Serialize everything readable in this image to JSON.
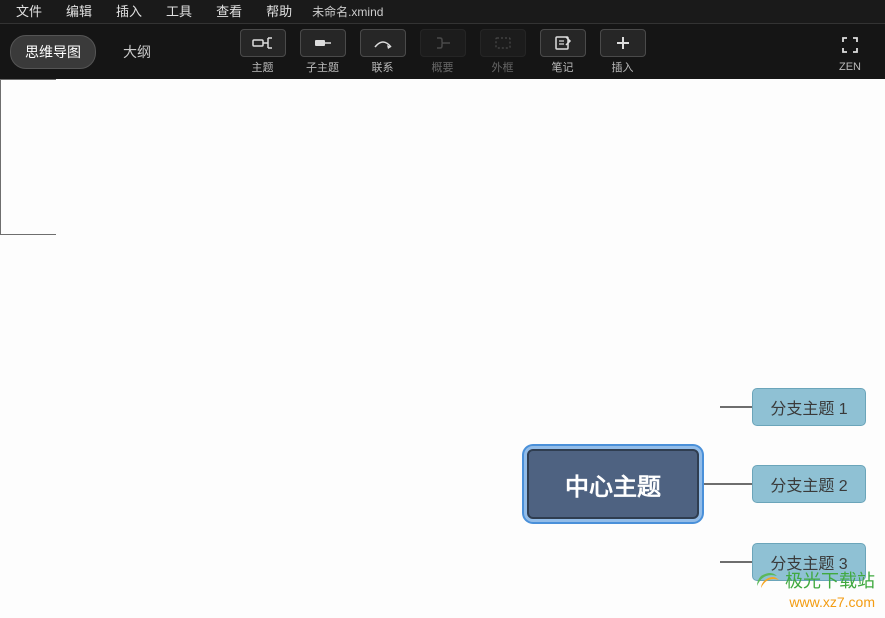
{
  "menubar": {
    "file": "文件",
    "edit": "编辑",
    "insert": "插入",
    "tools": "工具",
    "view": "查看",
    "help": "帮助",
    "doc_title": "未命名.xmind"
  },
  "view_toggle": {
    "mindmap": "思维导图",
    "outline": "大纲"
  },
  "toolbar": {
    "topic": "主题",
    "subtopic": "子主题",
    "relation": "联系",
    "summary": "概要",
    "boundary": "外框",
    "note": "笔记",
    "insert": "插入",
    "zen": "ZEN"
  },
  "mindmap": {
    "central": "中心主题",
    "branches": [
      "分支主题 1",
      "分支主题 2",
      "分支主题 3"
    ]
  },
  "watermark": {
    "text": "极光下载站",
    "url": "www.xz7.com"
  }
}
